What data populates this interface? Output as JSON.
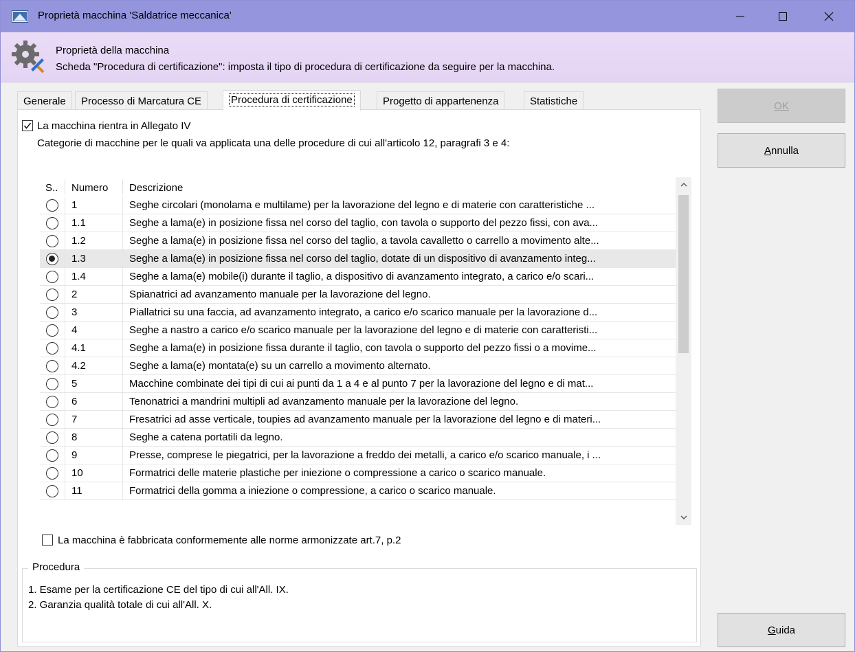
{
  "window": {
    "title": "Proprietà macchina 'Saldatrice meccanica'"
  },
  "header": {
    "title": "Proprietà della macchina",
    "subtitle": "Scheda \"Procedura di certificazione\": imposta il tipo di procedura di certificazione da seguire per la macchina."
  },
  "tabs": [
    {
      "label": "Generale"
    },
    {
      "label": "Processo di Marcatura CE"
    },
    {
      "label": "Procedura di certificazione"
    },
    {
      "label": "Progetto di appartenenza"
    },
    {
      "label": "Statistiche"
    }
  ],
  "active_tab": 2,
  "allegato": {
    "checkbox_label": "La macchina rientra in Allegato IV",
    "checked": true,
    "categories_text": "Categorie di macchine per le quali va applicata una delle procedure di cui all'articolo 12, paragrafi 3 e 4:"
  },
  "grid": {
    "columns": [
      "S..",
      "Numero",
      "Descrizione"
    ],
    "selected_index": 3,
    "rows": [
      {
        "numero": "1",
        "descrizione": "Seghe circolari (monolama e multilame) per la lavorazione del legno e di materie con caratteristiche ..."
      },
      {
        "numero": "1.1",
        "descrizione": "Seghe a lama(e) in posizione fissa nel corso del taglio, con tavola o supporto del pezzo fissi, con ava..."
      },
      {
        "numero": "1.2",
        "descrizione": "Seghe a lama(e) in posizione fissa nel corso del taglio, a tavola cavalletto o carrello a movimento alte..."
      },
      {
        "numero": "1.3",
        "descrizione": "Seghe a lama(e) in posizione fissa nel corso del taglio, dotate di un dispositivo di avanzamento integ..."
      },
      {
        "numero": "1.4",
        "descrizione": "Seghe a lama(e) mobile(i) durante il taglio, a dispositivo di avanzamento integrato, a carico e/o scari..."
      },
      {
        "numero": "2",
        "descrizione": "Spianatrici ad avanzamento manuale per la lavorazione del legno."
      },
      {
        "numero": "3",
        "descrizione": "Piallatrici su una faccia, ad avanzamento integrato, a carico e/o scarico manuale per la lavorazione d..."
      },
      {
        "numero": "4",
        "descrizione": "Seghe a nastro a carico e/o scarico manuale per la lavorazione del legno e di materie con caratteristi..."
      },
      {
        "numero": "4.1",
        "descrizione": "Seghe a lama(e) in posizione fissa durante il taglio, con tavola o supporto del pezzo fissi o a movime..."
      },
      {
        "numero": "4.2",
        "descrizione": "Seghe a lama(e) montata(e) su un carrello a movimento alternato."
      },
      {
        "numero": "5",
        "descrizione": "Macchine combinate dei tipi di cui ai punti da 1 a 4 e al punto 7 per la lavorazione del legno e di mat..."
      },
      {
        "numero": "6",
        "descrizione": "Tenonatrici a mandrini multipli ad avanzamento manuale per la lavorazione del legno."
      },
      {
        "numero": "7",
        "descrizione": "Fresatrici ad asse verticale, toupies ad avanzamento manuale per la lavorazione del legno e di materi..."
      },
      {
        "numero": "8",
        "descrizione": "Seghe a catena portatili da legno."
      },
      {
        "numero": "9",
        "descrizione": "Presse, comprese le piegatrici, per la lavorazione a freddo dei metalli, a carico e/o scarico manuale, i ..."
      },
      {
        "numero": "10",
        "descrizione": "Formatrici delle materie plastiche per iniezione o compressione a carico o scarico manuale."
      },
      {
        "numero": "11",
        "descrizione": "Formatrici della gomma a iniezione o compressione, a carico o scarico manuale."
      }
    ]
  },
  "norme": {
    "checkbox_label": "La macchina è fabbricata conformemente alle norme armonizzate art.7, p.2",
    "checked": false
  },
  "procedura": {
    "legend": "Procedura",
    "lines": [
      "1. Esame per la certificazione CE del tipo di cui all'All. IX.",
      "2. Garanzia qualità totale di cui all'All. X."
    ]
  },
  "buttons": {
    "ok": {
      "label": "OK",
      "enabled": false
    },
    "annulla": {
      "label": "Annulla",
      "enabled": true
    },
    "guida": {
      "label": "Guida",
      "enabled": true
    }
  },
  "icons": {
    "app": "machine-app-icon",
    "header": "gear-wrench-icon"
  }
}
